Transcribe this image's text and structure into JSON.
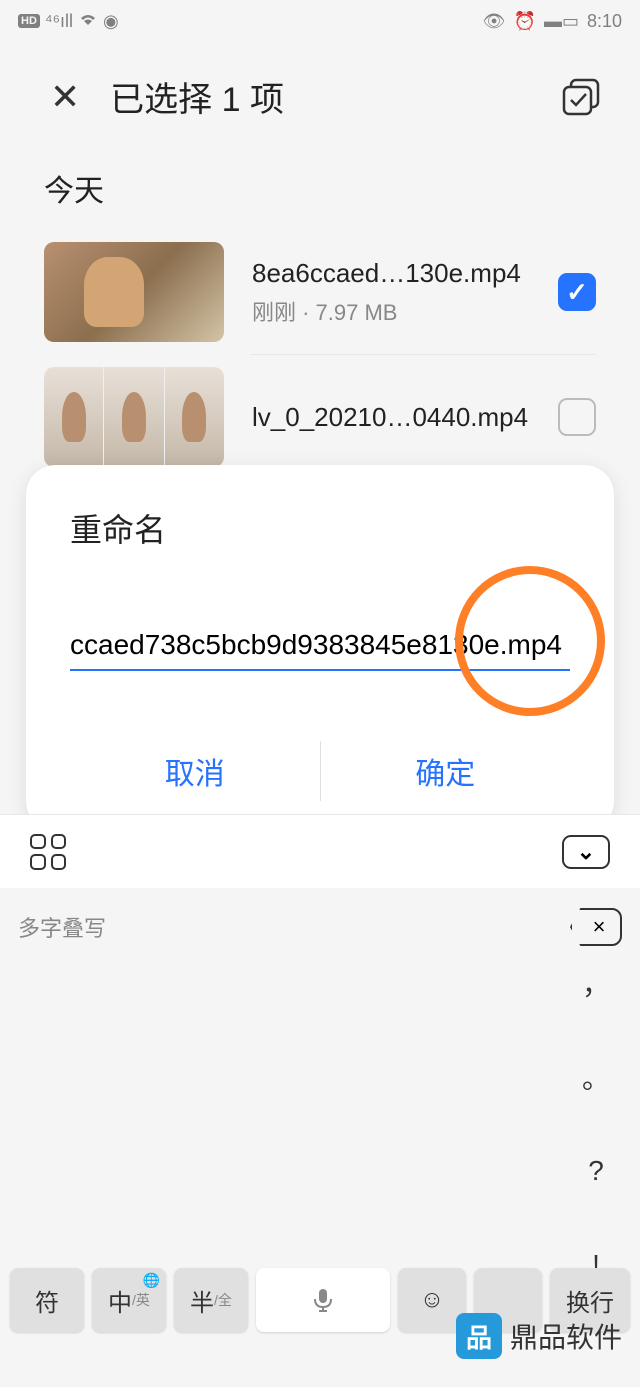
{
  "status": {
    "time": "8:10"
  },
  "header": {
    "title": "已选择 1 项"
  },
  "section": {
    "today": "今天"
  },
  "files": [
    {
      "name": "8ea6ccaed…130e.mp4",
      "meta": "刚刚 · 7.97 MB",
      "checked": true
    },
    {
      "name": "lv_0_20210…0440.mp4",
      "meta": "",
      "checked": false
    }
  ],
  "dialog": {
    "title": "重命名",
    "value": "ccaed738c5bcb9d9383845e8130e.mp4",
    "cancel": "取消",
    "confirm": "确定"
  },
  "keyboard": {
    "suggestion": "多字叠写",
    "punct": [
      "，",
      "。",
      "?",
      "!"
    ],
    "sym": "符",
    "lang_main": "中",
    "lang_sub": "/英",
    "half_main": "半",
    "half_sub": "/全",
    "enter": "换行"
  },
  "watermark": "鼎品软件"
}
